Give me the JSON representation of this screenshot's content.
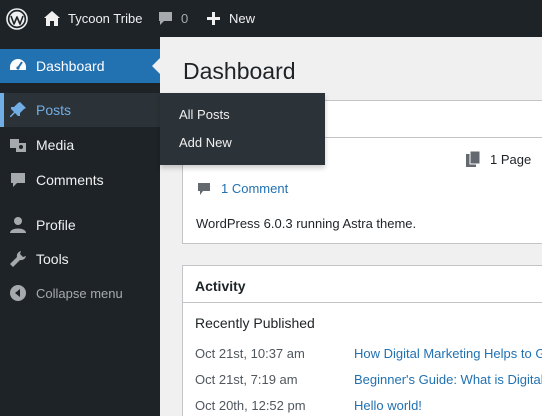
{
  "admin_bar": {
    "site_name": "Tycoon Tribe",
    "comments_count": "0",
    "new_label": "New"
  },
  "sidebar": {
    "items": [
      {
        "label": "Dashboard",
        "icon": "dashboard-icon"
      },
      {
        "label": "Posts",
        "icon": "pin-icon"
      },
      {
        "label": "Media",
        "icon": "media-icon"
      },
      {
        "label": "Comments",
        "icon": "comment-icon"
      },
      {
        "label": "Profile",
        "icon": "user-icon"
      },
      {
        "label": "Tools",
        "icon": "wrench-icon"
      },
      {
        "label": "Collapse menu",
        "icon": "collapse-icon"
      }
    ]
  },
  "flyout": {
    "items": [
      "All Posts",
      "Add New"
    ]
  },
  "main": {
    "page_title": "Dashboard",
    "glance": {
      "pages": "1 Page",
      "comments": "1 Comment",
      "running": "WordPress 6.0.3 running Astra theme."
    },
    "activity": {
      "title": "Activity",
      "subtitle": "Recently Published",
      "rows": [
        {
          "date": "Oct 21st, 10:37 am",
          "title": "How Digital Marketing Helps to G"
        },
        {
          "date": "Oct 21st, 7:19 am",
          "title": "Beginner's Guide: What is Digital"
        },
        {
          "date": "Oct 20th, 12:52 pm",
          "title": "Hello world!"
        }
      ]
    }
  },
  "colors": {
    "admin_dark": "#1d2327",
    "accent": "#2271b1",
    "hover": "#72aee6",
    "background": "#f0f0f1"
  }
}
